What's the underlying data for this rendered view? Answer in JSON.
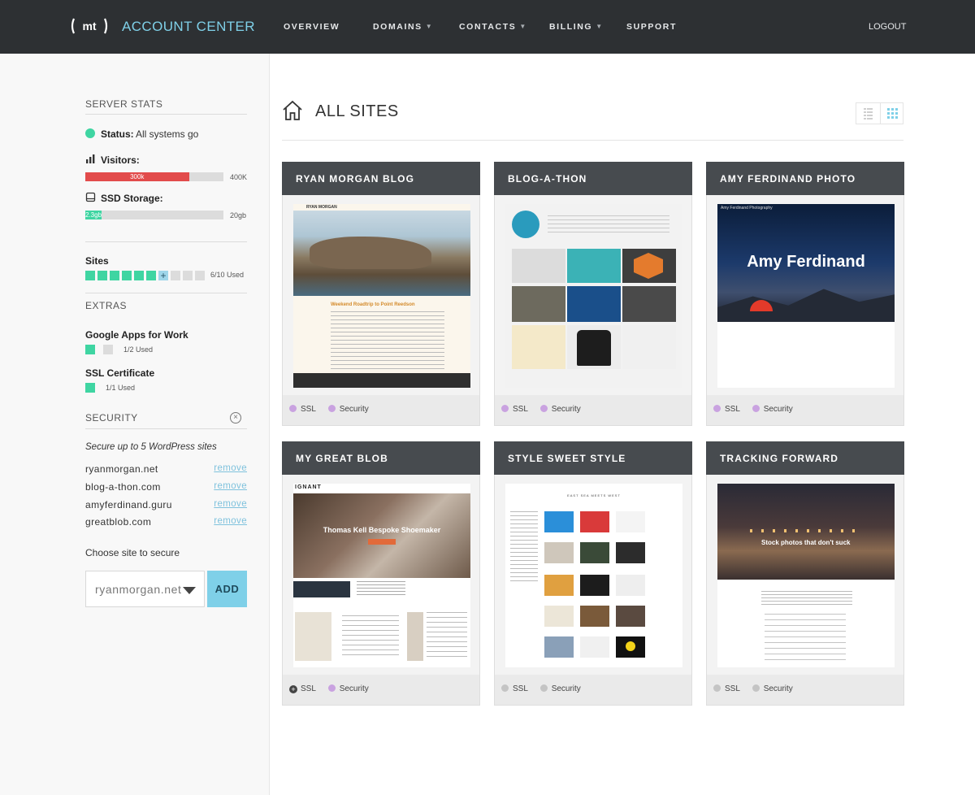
{
  "header": {
    "logo_text": "mt",
    "app_title": "ACCOUNT CENTER",
    "nav": [
      {
        "label": "OVERVIEW",
        "dropdown": false
      },
      {
        "label": "DOMAINS",
        "dropdown": true
      },
      {
        "label": "CONTACTS",
        "dropdown": true
      },
      {
        "label": "BILLING",
        "dropdown": true
      },
      {
        "label": "SUPPORT",
        "dropdown": false
      }
    ],
    "logout_label": "LOGOUT"
  },
  "sidebar": {
    "server_stats_heading": "SERVER STATS",
    "status_label": "Status:",
    "status_value": "All systems go",
    "visitors_label": "Visitors:",
    "visitors_value": "300k",
    "visitors_max": "400K",
    "visitors_fraction": 0.75,
    "storage_label": "SSD Storage:",
    "storage_value": "2.3gb",
    "storage_max": "20gb",
    "storage_fraction": 0.115,
    "sites_label": "Sites",
    "sites_used": 6,
    "sites_total": 10,
    "sites_usage": "6/10 Used",
    "extras_heading": "EXTRAS",
    "google_apps_label": "Google Apps for Work",
    "google_apps_usage": "1/2 Used",
    "ssl_label": "SSL Certificate",
    "ssl_usage": "1/1 Used",
    "security_heading": "SECURITY",
    "security_note": "Secure up to 5 WordPress sites",
    "secured_domains": [
      {
        "domain": "ryanmorgan.net",
        "action": "remove"
      },
      {
        "domain": "blog-a-thon.com",
        "action": "remove"
      },
      {
        "domain": "amyferdinand.guru",
        "action": "remove"
      },
      {
        "domain": "greatblob.com",
        "action": "remove"
      }
    ],
    "choose_label": "Choose site to secure",
    "select_value": "ryanmorgan.net",
    "add_label": "ADD"
  },
  "main": {
    "title": "ALL SITES",
    "sites": [
      {
        "name": "RYAN MORGAN BLOG",
        "ssl": "SSL",
        "security": "Security",
        "ssl_status": "purple",
        "security_status": "purple"
      },
      {
        "name": "BLOG-A-THON",
        "ssl": "SSL",
        "security": "Security",
        "ssl_status": "purple",
        "security_status": "purple"
      },
      {
        "name": "AMY FERDINAND PHOTO",
        "ssl": "SSL",
        "security": "Security",
        "ssl_status": "purple",
        "security_status": "purple"
      },
      {
        "name": "MY GREAT BLOB",
        "ssl": "SSL",
        "security": "Security",
        "ssl_status": "add",
        "security_status": "purple"
      },
      {
        "name": "STYLE SWEET STYLE",
        "ssl": "SSL",
        "security": "Security",
        "ssl_status": "gray",
        "security_status": "gray"
      },
      {
        "name": "TRACKING FORWARD",
        "ssl": "SSL",
        "security": "Security",
        "ssl_status": "gray",
        "security_status": "gray"
      }
    ],
    "thumbnails": {
      "ryan": {
        "brand": "RYAN MORGAN",
        "post_title": "Weekend Roadtrip to Point Reedson"
      },
      "amy": {
        "brand": "Amy Ferdinand Photography",
        "hero": "Amy Ferdinand"
      },
      "blob": {
        "brand": "IGNANT",
        "hero": "Thomas Kell Bespoke Shoemaker"
      },
      "style": {
        "brand": "EAST SEA MEETS WEST"
      },
      "tracking": {
        "hero": "Stock photos that don't suck"
      }
    }
  },
  "colors": {
    "accent": "#7fd0e8",
    "green": "#3fd5a2",
    "red": "#e24b4b",
    "purple": "#c9a2e0",
    "header": "#2d3033"
  }
}
